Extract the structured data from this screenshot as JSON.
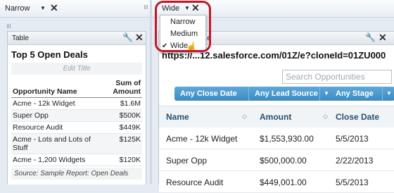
{
  "column_selectors": {
    "left": {
      "value": "Narrow"
    },
    "right": {
      "value": "Wide",
      "options": [
        "Narrow",
        "Medium",
        "Wide"
      ],
      "selected": "Wide"
    }
  },
  "left_panel": {
    "header": "Table",
    "title": "Top 5 Open Deals",
    "edit_title_placeholder": "Edit Title",
    "columns": [
      "Opportunity Name",
      "Sum of Amount"
    ],
    "rows": [
      [
        "Acme - 12k Widget",
        "$1.6M"
      ],
      [
        "Super Opp",
        "$500K"
      ],
      [
        "Resource Audit",
        "$449K"
      ],
      [
        "Acme - Lots and Lots of Stuff",
        "$125K"
      ],
      [
        "Acme - 1,200 Widgets",
        "$120K"
      ]
    ],
    "source": "Source: Sample Report: Open Deals"
  },
  "right_panel": {
    "header_partial": "...e",
    "url": "https://...12.salesforce.com/01Z/e?cloneId=01ZU000",
    "search_placeholder": "Search Opportunities",
    "filters": [
      "Any Close Date",
      "Any Lead Source",
      "Any Stage"
    ],
    "columns": [
      "Name",
      "Amount",
      "Close Date"
    ],
    "rows": [
      [
        "Acme - 12k Widget",
        "$1,553,930.00",
        "5/5/2013"
      ],
      [
        "Super Opp",
        "$500,000.00",
        "2/22/2013"
      ],
      [
        "Resource Audit",
        "$449,001.00",
        "5/5/2013"
      ]
    ]
  },
  "icons": {
    "caret": "▼",
    "close": "✕",
    "wrench": "🔧",
    "sort": "◇",
    "check": "✔",
    "cursor": "☝"
  },
  "colors": {
    "filter_button": "#3c8bc4",
    "highlight_circle": "#c2172a",
    "header_text": "#2b4f6b"
  }
}
